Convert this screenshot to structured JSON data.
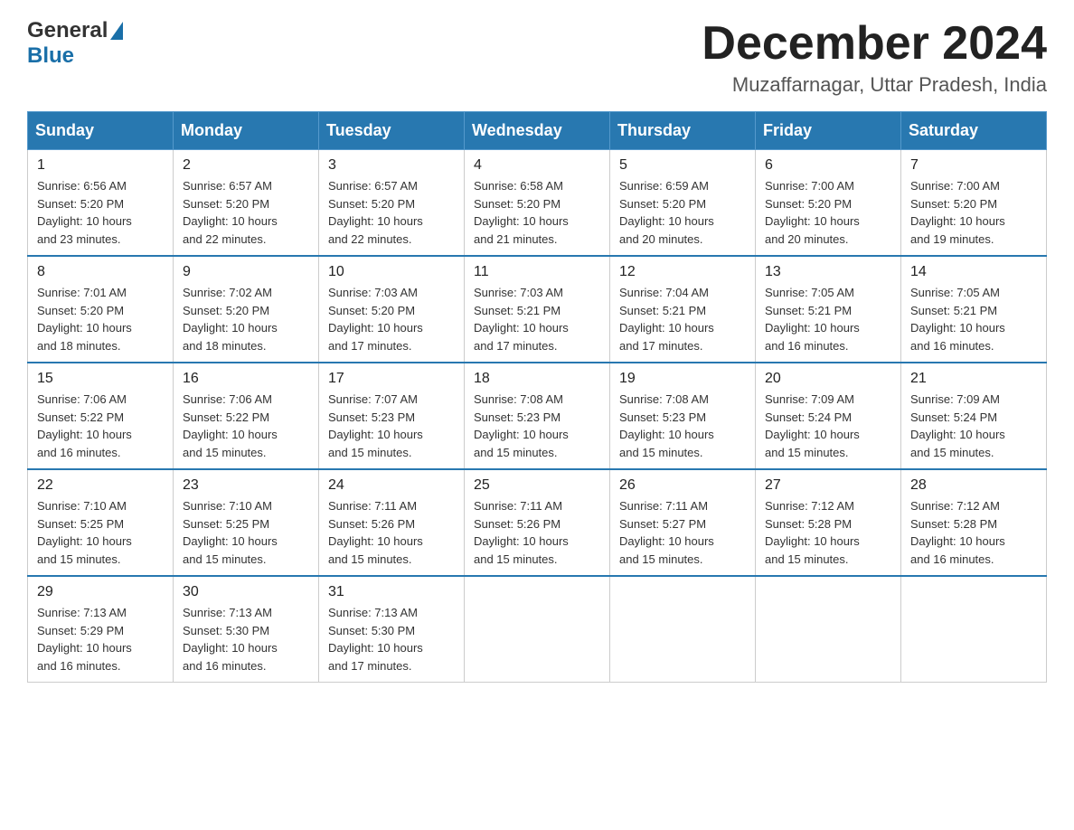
{
  "header": {
    "logo_general": "General",
    "logo_blue": "Blue",
    "month_title": "December 2024",
    "location": "Muzaffarnagar, Uttar Pradesh, India"
  },
  "days_of_week": [
    "Sunday",
    "Monday",
    "Tuesday",
    "Wednesday",
    "Thursday",
    "Friday",
    "Saturday"
  ],
  "weeks": [
    [
      {
        "day": "1",
        "sunrise": "6:56 AM",
        "sunset": "5:20 PM",
        "daylight": "10 hours and 23 minutes."
      },
      {
        "day": "2",
        "sunrise": "6:57 AM",
        "sunset": "5:20 PM",
        "daylight": "10 hours and 22 minutes."
      },
      {
        "day": "3",
        "sunrise": "6:57 AM",
        "sunset": "5:20 PM",
        "daylight": "10 hours and 22 minutes."
      },
      {
        "day": "4",
        "sunrise": "6:58 AM",
        "sunset": "5:20 PM",
        "daylight": "10 hours and 21 minutes."
      },
      {
        "day": "5",
        "sunrise": "6:59 AM",
        "sunset": "5:20 PM",
        "daylight": "10 hours and 20 minutes."
      },
      {
        "day": "6",
        "sunrise": "7:00 AM",
        "sunset": "5:20 PM",
        "daylight": "10 hours and 20 minutes."
      },
      {
        "day": "7",
        "sunrise": "7:00 AM",
        "sunset": "5:20 PM",
        "daylight": "10 hours and 19 minutes."
      }
    ],
    [
      {
        "day": "8",
        "sunrise": "7:01 AM",
        "sunset": "5:20 PM",
        "daylight": "10 hours and 18 minutes."
      },
      {
        "day": "9",
        "sunrise": "7:02 AM",
        "sunset": "5:20 PM",
        "daylight": "10 hours and 18 minutes."
      },
      {
        "day": "10",
        "sunrise": "7:03 AM",
        "sunset": "5:20 PM",
        "daylight": "10 hours and 17 minutes."
      },
      {
        "day": "11",
        "sunrise": "7:03 AM",
        "sunset": "5:21 PM",
        "daylight": "10 hours and 17 minutes."
      },
      {
        "day": "12",
        "sunrise": "7:04 AM",
        "sunset": "5:21 PM",
        "daylight": "10 hours and 17 minutes."
      },
      {
        "day": "13",
        "sunrise": "7:05 AM",
        "sunset": "5:21 PM",
        "daylight": "10 hours and 16 minutes."
      },
      {
        "day": "14",
        "sunrise": "7:05 AM",
        "sunset": "5:21 PM",
        "daylight": "10 hours and 16 minutes."
      }
    ],
    [
      {
        "day": "15",
        "sunrise": "7:06 AM",
        "sunset": "5:22 PM",
        "daylight": "10 hours and 16 minutes."
      },
      {
        "day": "16",
        "sunrise": "7:06 AM",
        "sunset": "5:22 PM",
        "daylight": "10 hours and 15 minutes."
      },
      {
        "day": "17",
        "sunrise": "7:07 AM",
        "sunset": "5:23 PM",
        "daylight": "10 hours and 15 minutes."
      },
      {
        "day": "18",
        "sunrise": "7:08 AM",
        "sunset": "5:23 PM",
        "daylight": "10 hours and 15 minutes."
      },
      {
        "day": "19",
        "sunrise": "7:08 AM",
        "sunset": "5:23 PM",
        "daylight": "10 hours and 15 minutes."
      },
      {
        "day": "20",
        "sunrise": "7:09 AM",
        "sunset": "5:24 PM",
        "daylight": "10 hours and 15 minutes."
      },
      {
        "day": "21",
        "sunrise": "7:09 AM",
        "sunset": "5:24 PM",
        "daylight": "10 hours and 15 minutes."
      }
    ],
    [
      {
        "day": "22",
        "sunrise": "7:10 AM",
        "sunset": "5:25 PM",
        "daylight": "10 hours and 15 minutes."
      },
      {
        "day": "23",
        "sunrise": "7:10 AM",
        "sunset": "5:25 PM",
        "daylight": "10 hours and 15 minutes."
      },
      {
        "day": "24",
        "sunrise": "7:11 AM",
        "sunset": "5:26 PM",
        "daylight": "10 hours and 15 minutes."
      },
      {
        "day": "25",
        "sunrise": "7:11 AM",
        "sunset": "5:26 PM",
        "daylight": "10 hours and 15 minutes."
      },
      {
        "day": "26",
        "sunrise": "7:11 AM",
        "sunset": "5:27 PM",
        "daylight": "10 hours and 15 minutes."
      },
      {
        "day": "27",
        "sunrise": "7:12 AM",
        "sunset": "5:28 PM",
        "daylight": "10 hours and 15 minutes."
      },
      {
        "day": "28",
        "sunrise": "7:12 AM",
        "sunset": "5:28 PM",
        "daylight": "10 hours and 16 minutes."
      }
    ],
    [
      {
        "day": "29",
        "sunrise": "7:13 AM",
        "sunset": "5:29 PM",
        "daylight": "10 hours and 16 minutes."
      },
      {
        "day": "30",
        "sunrise": "7:13 AM",
        "sunset": "5:30 PM",
        "daylight": "10 hours and 16 minutes."
      },
      {
        "day": "31",
        "sunrise": "7:13 AM",
        "sunset": "5:30 PM",
        "daylight": "10 hours and 17 minutes."
      },
      null,
      null,
      null,
      null
    ]
  ],
  "labels": {
    "sunrise": "Sunrise:",
    "sunset": "Sunset:",
    "daylight": "Daylight:"
  }
}
